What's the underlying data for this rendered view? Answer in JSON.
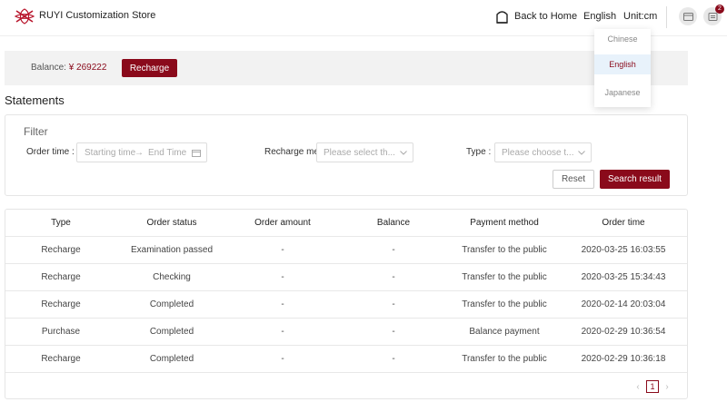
{
  "header": {
    "brand": "RUYI Customization Store",
    "home_label": "Back to Home",
    "language": "English",
    "unit": "Unit:cm",
    "cart_count": "2",
    "brand_color": "#8a0a1b"
  },
  "language_menu": {
    "options": [
      "Chinese",
      "English",
      "Japanese"
    ],
    "selected": "English"
  },
  "balance": {
    "label": "Balance:",
    "value": "¥ 269222",
    "recharge_label": "Recharge"
  },
  "page_title": "Statements",
  "filter": {
    "title": "Filter",
    "order_time_label": "Order time :",
    "start_placeholder": "Starting time",
    "arrow": "→",
    "end_placeholder": "End Time",
    "recharge_method_label": "Recharge me",
    "recharge_method_placeholder": "Please select th...",
    "type_label": "Type :",
    "type_placeholder": "Please choose t...",
    "reset_label": "Reset",
    "search_label": "Search result"
  },
  "table": {
    "columns": [
      "Type",
      "Order status",
      "Order amount",
      "Balance",
      "Payment method",
      "Order time"
    ],
    "rows": [
      [
        "Recharge",
        "Examination passed",
        "-",
        "-",
        "Transfer to the public",
        "2020-03-25 16:03:55"
      ],
      [
        "Recharge",
        "Checking",
        "-",
        "-",
        "Transfer to the public",
        "2020-03-25 15:34:43"
      ],
      [
        "Recharge",
        "Completed",
        "-",
        "-",
        "Transfer to the public",
        "2020-02-14 20:03:04"
      ],
      [
        "Purchase",
        "Completed",
        "-",
        "-",
        "Balance payment",
        "2020-02-29 10:36:54"
      ],
      [
        "Recharge",
        "Completed",
        "-",
        "-",
        "Transfer to the public",
        "2020-02-29 10:36:18"
      ]
    ]
  },
  "pagination": {
    "prev": "‹",
    "current": "1",
    "next": "›"
  }
}
